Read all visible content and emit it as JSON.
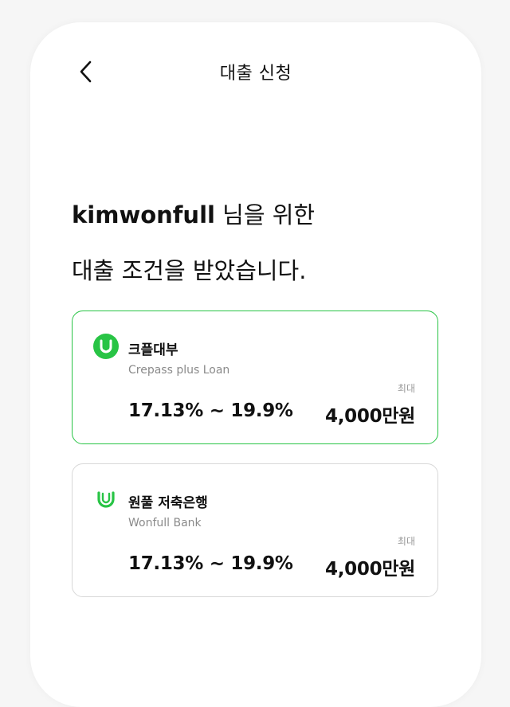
{
  "header": {
    "title": "대출 신청"
  },
  "headline": {
    "username": "kimwonfull",
    "line1_suffix": " 님을 위한",
    "line2": "대출 조건을 받았습니다."
  },
  "colors": {
    "accent": "#28c445",
    "border_selected": "#28c445",
    "border_default": "#d8d8d8"
  },
  "offers": [
    {
      "lender": "크플대부",
      "lender_en": "Crepass plus Loan",
      "max_label": "최대",
      "rate": "17.13% ~ 19.9%",
      "amount": "4,000만원",
      "icon": "crepass-logo-icon",
      "selected": true
    },
    {
      "lender": "원풀 저축은행",
      "lender_en": "Wonfull Bank",
      "max_label": "최대",
      "rate": "17.13% ~ 19.9%",
      "amount": "4,000만원",
      "icon": "wonfull-logo-icon",
      "selected": false
    }
  ]
}
